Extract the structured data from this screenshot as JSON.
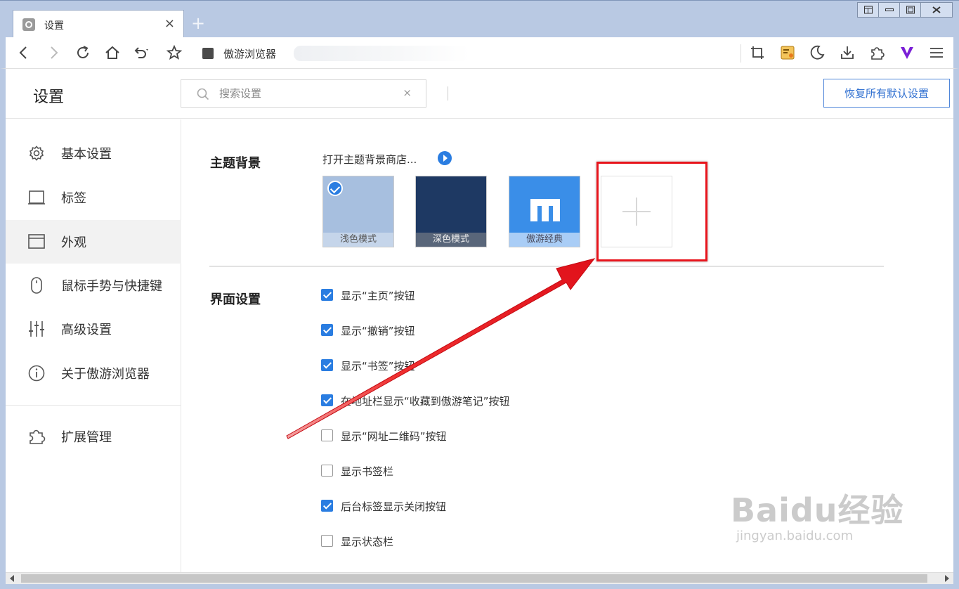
{
  "browser": {
    "tab_title": "设置",
    "tab_close": "×",
    "new_tab": "+",
    "address_site_name": "傲游浏览器"
  },
  "header": {
    "title": "设置",
    "search_placeholder": "搜索设置",
    "search_clear": "×",
    "restore_button": "恢复所有默认设置"
  },
  "sidebar": {
    "items": [
      {
        "label": "基本设置",
        "icon": "gear-icon"
      },
      {
        "label": "标签",
        "icon": "tab-icon"
      },
      {
        "label": "外观",
        "icon": "window-icon",
        "active": true
      },
      {
        "label": "鼠标手势与快捷键",
        "icon": "mouse-icon"
      },
      {
        "label": "高级设置",
        "icon": "sliders-icon"
      },
      {
        "label": "关于傲游浏览器",
        "icon": "info-icon"
      },
      {
        "label": "扩展管理",
        "icon": "puzzle-icon"
      }
    ]
  },
  "theme_section": {
    "title": "主题背景",
    "store_link": "打开主题背景商店...",
    "themes": [
      {
        "label": "浅色模式",
        "selected": true
      },
      {
        "label": "深色模式",
        "selected": false
      },
      {
        "label": "傲游经典",
        "selected": false
      }
    ],
    "add_label": "+"
  },
  "ui_section": {
    "title": "界面设置",
    "options": [
      {
        "label": "显示“主页”按钮",
        "checked": true
      },
      {
        "label": "显示“撤销”按钮",
        "checked": true
      },
      {
        "label": "显示“书签”按钮",
        "checked": true
      },
      {
        "label": "在地址栏显示“收藏到傲游笔记”按钮",
        "checked": true
      },
      {
        "label": "显示“网址二维码”按钮",
        "checked": false
      },
      {
        "label": "显示书签栏",
        "checked": false
      },
      {
        "label": "后台标签显示关闭按钮",
        "checked": true
      },
      {
        "label": "显示状态栏",
        "checked": false
      }
    ]
  },
  "watermark": {
    "main": "Baidu经验",
    "sub": "jingyan.baidu.com"
  },
  "colors": {
    "accent": "#2a7de1",
    "annotation_red": "#e8141c",
    "frame": "#b9c9e3"
  }
}
